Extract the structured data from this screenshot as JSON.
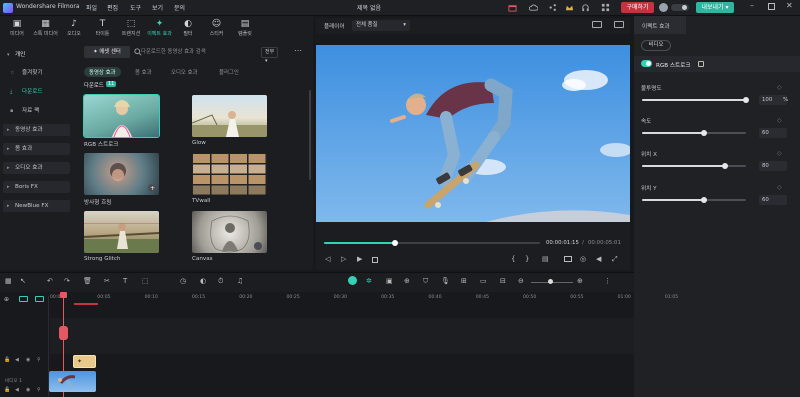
{
  "app": {
    "name": "Wondershare Filmora",
    "project_title": "제목 없음"
  },
  "menu": [
    "파일",
    "편집",
    "도구",
    "보기",
    "문의"
  ],
  "titlebar": {
    "buy_label": "구매하기",
    "export_label": "내보내기"
  },
  "tools": [
    {
      "label": "미디어",
      "icon": "media-icon"
    },
    {
      "label": "스톡 미디어",
      "icon": "stock-media-icon"
    },
    {
      "label": "오디오",
      "icon": "audio-icon"
    },
    {
      "label": "타이틀",
      "icon": "title-icon"
    },
    {
      "label": "트랜지션",
      "icon": "transition-icon"
    },
    {
      "label": "이펙트 효과",
      "icon": "effects-icon",
      "active": true
    },
    {
      "label": "필터",
      "icon": "filter-icon"
    },
    {
      "label": "스티커",
      "icon": "sticker-icon"
    },
    {
      "label": "템플릿",
      "icon": "template-icon"
    }
  ],
  "sidebar": {
    "items": [
      {
        "label": "개인",
        "type": "header"
      },
      {
        "label": "즐겨찾기"
      },
      {
        "label": "다운로드",
        "active": true
      },
      {
        "label": "자료 팩"
      },
      {
        "label": "동영상 효과"
      },
      {
        "label": "몸 효과"
      },
      {
        "label": "오디오 효과"
      },
      {
        "label": "Boris FX"
      },
      {
        "label": "NewBlue FX"
      }
    ]
  },
  "content": {
    "store_button": "에셋 센터",
    "search_placeholder": "다운로드한 동영상 효과 검색",
    "filter_label": "전부",
    "subtabs": [
      "동영상 효과",
      "몸 효과",
      "오디오 효과",
      "플러그인"
    ],
    "section_label": "다운로드",
    "section_count": "11",
    "effects": [
      {
        "label": "RGB 스트로크",
        "selected": true
      },
      {
        "label": "Glow"
      },
      {
        "label": "방사형 흐림"
      },
      {
        "label": "TVwall"
      },
      {
        "label": "Strong Glitch"
      },
      {
        "label": "Canvas"
      }
    ]
  },
  "preview": {
    "player_label": "플레이어",
    "quality_label": "전체 품질",
    "current_time": "00:00:01:15",
    "total_time": "00:00:05:01",
    "progress": 0.33
  },
  "right_panel": {
    "tab": "이펙트 효과",
    "subtab": "비디오",
    "effect_name": "RGB 스트로크",
    "params": [
      {
        "label": "불투명도",
        "value": "100",
        "unit": "%",
        "fraction": 1.0
      },
      {
        "label": "속도",
        "value": "60",
        "unit": "",
        "fraction": 0.6
      },
      {
        "label": "위치 X",
        "value": "80",
        "unit": "",
        "fraction": 0.8
      },
      {
        "label": "위치 Y",
        "value": "60",
        "unit": "",
        "fraction": 0.6
      }
    ]
  },
  "timeline": {
    "ruler": [
      "00:00",
      "00:05",
      "00:10",
      "00:15",
      "00:20",
      "00:25",
      "00:30",
      "00:35",
      "00:40",
      "00:45",
      "00:50",
      "00:55",
      "01:00",
      "01:05"
    ],
    "track_label": "비디오 1"
  }
}
